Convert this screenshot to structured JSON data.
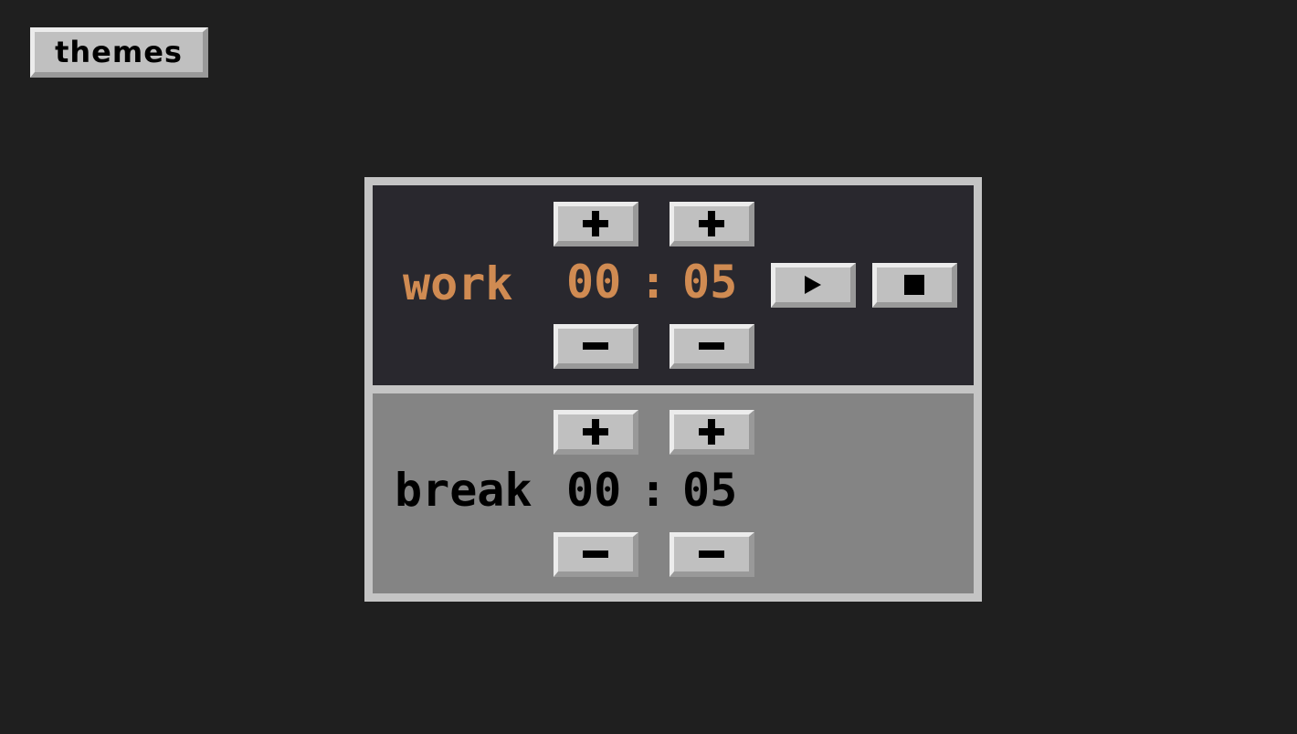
{
  "header": {
    "themes_label": "themes"
  },
  "work": {
    "label": "work",
    "minutes": "00",
    "separator": ":",
    "seconds": "05"
  },
  "break": {
    "label": "break",
    "minutes": "00",
    "separator": ":",
    "seconds": "05"
  },
  "colors": {
    "accent": "#d08b52",
    "work_bg": "#29282e",
    "break_bg": "#848484"
  }
}
